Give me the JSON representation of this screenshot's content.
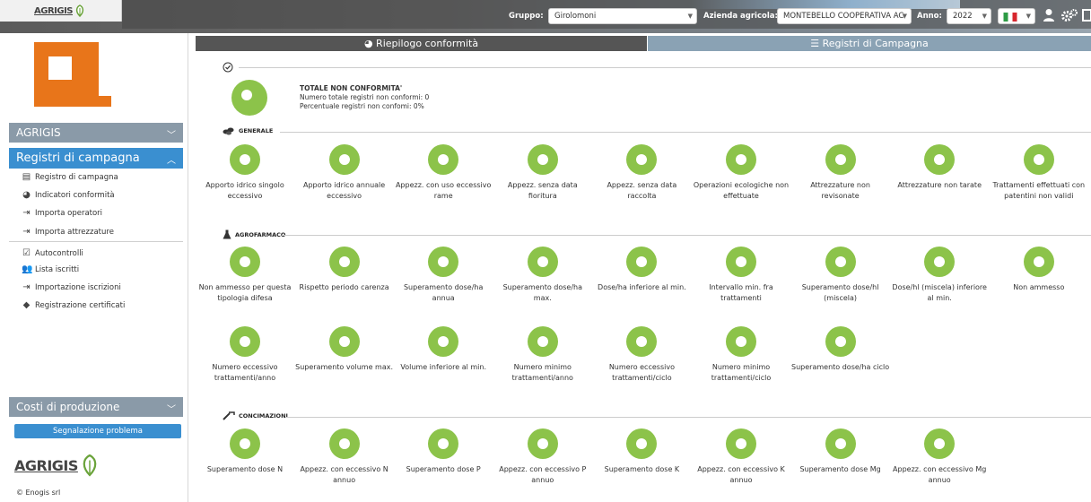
{
  "header": {
    "brand": "AGRIGIS",
    "gruppo_label": "Gruppo:",
    "gruppo_value": "Girolomoni",
    "azienda_label": "Azienda agricola:",
    "azienda_value": "MONTEBELLO COOPERATIVA AC",
    "anno_label": "Anno:",
    "anno_value": "2022"
  },
  "sidebar": {
    "section_agrigis": "AGRIGIS",
    "section_registri": "Registri di campagna",
    "items": [
      {
        "label": "Registro di campagna",
        "icon": "book-icon"
      },
      {
        "label": "Indicatori conformità",
        "icon": "pie-chart-icon"
      },
      {
        "label": "Importa operatori",
        "icon": "import-icon"
      },
      {
        "label": "Importa attrezzature",
        "icon": "import-icon"
      },
      {
        "label": "Autocontrolli",
        "icon": "checklist-icon"
      },
      {
        "label": "Lista iscritti",
        "icon": "users-icon"
      },
      {
        "label": "Importazione iscrizioni",
        "icon": "import-icon"
      },
      {
        "label": "Registrazione certificati",
        "icon": "tag-icon"
      }
    ],
    "section_costi": "Costi di produzione",
    "report_button": "Segnalazione problema",
    "footer_brand": "AGRIGIS",
    "copyright": "© Enogis srl"
  },
  "tabs": {
    "riepilogo": "Riepilogo conformità",
    "registri": "Registri di Campagna"
  },
  "summary": {
    "title": "TOTALE NON CONFORMITA'",
    "line1": "Numero totale registri non conformi: 0",
    "line2": "Percentuale registri non confomi: 0%",
    "percent_non_conforme": 0
  },
  "sections": {
    "generale": "GENERALE",
    "agrofarmaco": "AGROFARMACO",
    "concimazioni": "CONCIMAZIONI"
  },
  "generale_items": [
    "Apporto idrico singolo eccessivo",
    "Apporto idrico annuale eccessivo",
    "Appezz. con uso eccessivo rame",
    "Appezz. senza data fioritura",
    "Appezz. senza data raccolta",
    "Operazioni ecologiche non effettuate",
    "Attrezzature non revisonate",
    "Attrezzature non tarate",
    "Trattamenti effettuati con patentini non validi"
  ],
  "agrofarmaco_items": [
    "Non ammesso per questa tipologia difesa",
    "Rispetto periodo carenza",
    "Superamento dose/ha annua",
    "Superamento dose/ha max.",
    "Dose/ha inferiore al min.",
    "Intervallo min. fra trattamenti",
    "Superamento dose/hl (miscela)",
    "Dose/hl (miscela) inferiore al min.",
    "Non ammesso",
    "Numero eccessivo trattamenti/anno",
    "Superamento volume max.",
    "Volume inferiore al min.",
    "Numero minimo trattamenti/anno",
    "Numero eccessivo trattamenti/ciclo",
    "Numero minimo trattamenti/ciclo",
    "Superamento dose/ha ciclo"
  ],
  "concimazioni_items": [
    "Superamento dose N",
    "Appezz. con eccessivo N annuo",
    "Superamento dose P",
    "Appezz. con eccessivo P annuo",
    "Superamento dose K",
    "Appezz. con eccessivo K annuo",
    "Superamento dose Mg",
    "Appezz. con eccessivo Mg annuo"
  ],
  "colors": {
    "accent": "#3a8fd0",
    "donut_green": "#8cc34a",
    "logo_orange": "#e8751a"
  }
}
